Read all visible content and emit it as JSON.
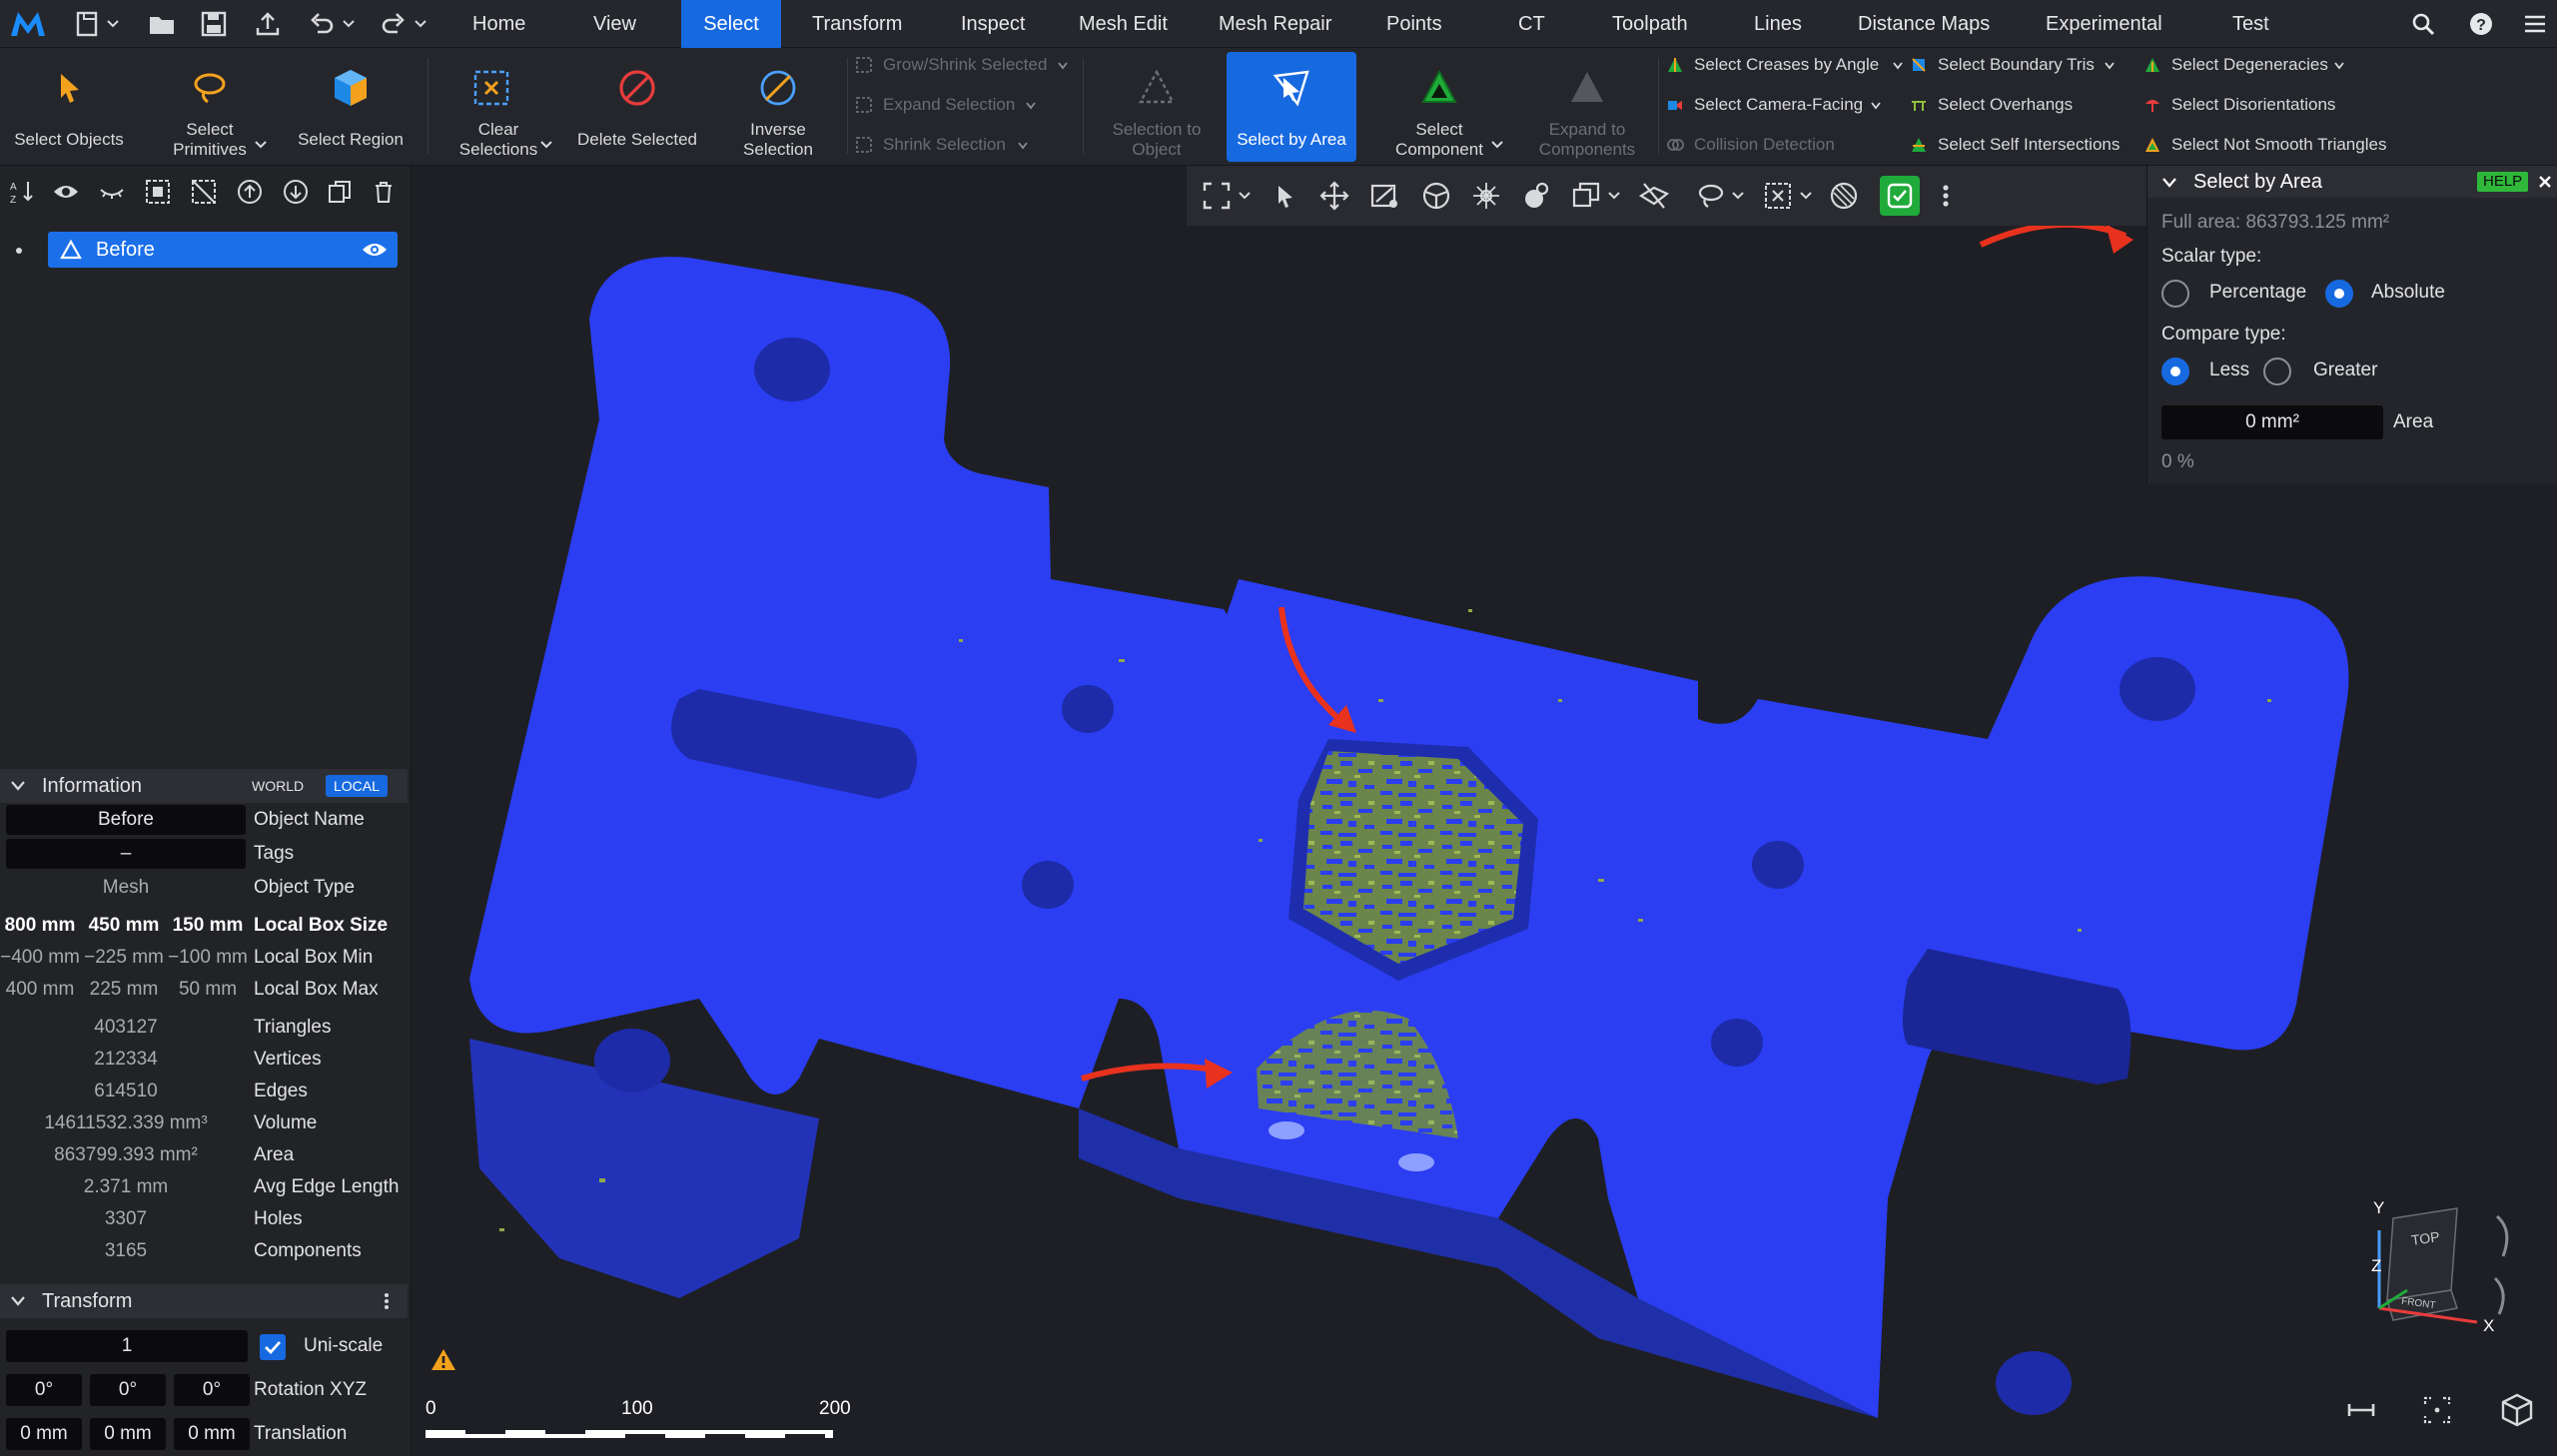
{
  "menubar": {
    "items": [
      "Home",
      "View",
      "Select",
      "Transform",
      "Inspect",
      "Mesh Edit",
      "Mesh Repair",
      "Points",
      "CT",
      "Toolpath",
      "Lines",
      "Distance Maps",
      "Experimental",
      "Test"
    ],
    "active": "Select"
  },
  "ribbon": {
    "select_objects": "Select Objects",
    "select_primitives": "Select Primitives",
    "select_region": "Select Region",
    "clear_selections": "Clear Selections",
    "delete_selected": "Delete Selected",
    "inverse_selection": "Inverse Selection",
    "grow_shrink": "Grow/Shrink Selected",
    "expand_selection": "Expand Selection",
    "shrink_selection": "Shrink Selection",
    "selection_to_object": "Selection to Object",
    "select_by_area": "Select by Area",
    "select_component": "Select Component",
    "expand_to_components": "Expand to Components",
    "select_creases": "Select Creases by Angle",
    "select_camera_facing": "Select Camera-Facing",
    "collision_detection": "Collision Detection",
    "select_boundary_tris": "Select Boundary Tris",
    "select_overhangs": "Select Overhangs",
    "select_self_intersections": "Select Self Intersections",
    "select_degeneracies": "Select Degeneracies",
    "select_disorientations": "Select Disorientations",
    "select_not_smooth": "Select Not Smooth Triangles"
  },
  "scene": {
    "object_name": "Before"
  },
  "info": {
    "title": "Information",
    "world": "WORLD",
    "local": "LOCAL",
    "object_name": "Before",
    "object_name_label": "Object Name",
    "tags": "–",
    "tags_label": "Tags",
    "object_type": "Mesh",
    "object_type_label": "Object Type",
    "box_size": [
      "800 mm",
      "450 mm",
      "150 mm"
    ],
    "box_size_label": "Local Box Size",
    "box_min": [
      "−400 mm",
      "−225 mm",
      "−100 mm"
    ],
    "box_min_label": "Local Box Min",
    "box_max": [
      "400 mm",
      "225 mm",
      "50 mm"
    ],
    "box_max_label": "Local Box Max",
    "triangles": "403127",
    "triangles_label": "Triangles",
    "vertices": "212334",
    "vertices_label": "Vertices",
    "edges": "614510",
    "edges_label": "Edges",
    "volume": "14611532.339 mm³",
    "volume_label": "Volume",
    "area": "863799.393 mm²",
    "area_label": "Area",
    "avg_edge": "2.371 mm",
    "avg_edge_label": "Avg Edge Length",
    "holes": "3307",
    "holes_label": "Holes",
    "components": "3165",
    "components_label": "Components"
  },
  "transform": {
    "title": "Transform",
    "scale": "1",
    "uniscale_label": "Uni-scale",
    "rotation": [
      "0°",
      "0°",
      "0°"
    ],
    "rotation_label": "Rotation XYZ",
    "translation": [
      "0 mm",
      "0 mm",
      "0 mm"
    ],
    "translation_label": "Translation"
  },
  "select_by_area": {
    "title": "Select by Area",
    "help": "HELP",
    "full_area": "Full area: 863793.125 mm²",
    "scalar_type_label": "Scalar type:",
    "percentage": "Percentage",
    "absolute": "Absolute",
    "compare_type_label": "Compare type:",
    "less": "Less",
    "greater": "Greater",
    "area_value": "0 mm²",
    "area_label": "Area",
    "percent_result": "0 %"
  },
  "scale_bar": {
    "ticks": [
      "0",
      "100",
      "200"
    ]
  },
  "view_cube": {
    "top": "TOP",
    "front": "FRONT",
    "x": "X",
    "y": "Y",
    "z": "Z"
  },
  "colors": {
    "accent": "#1769e0",
    "mesh": "#2b3ef2",
    "selected": "#8faa45",
    "arrow": "#e8321e"
  }
}
